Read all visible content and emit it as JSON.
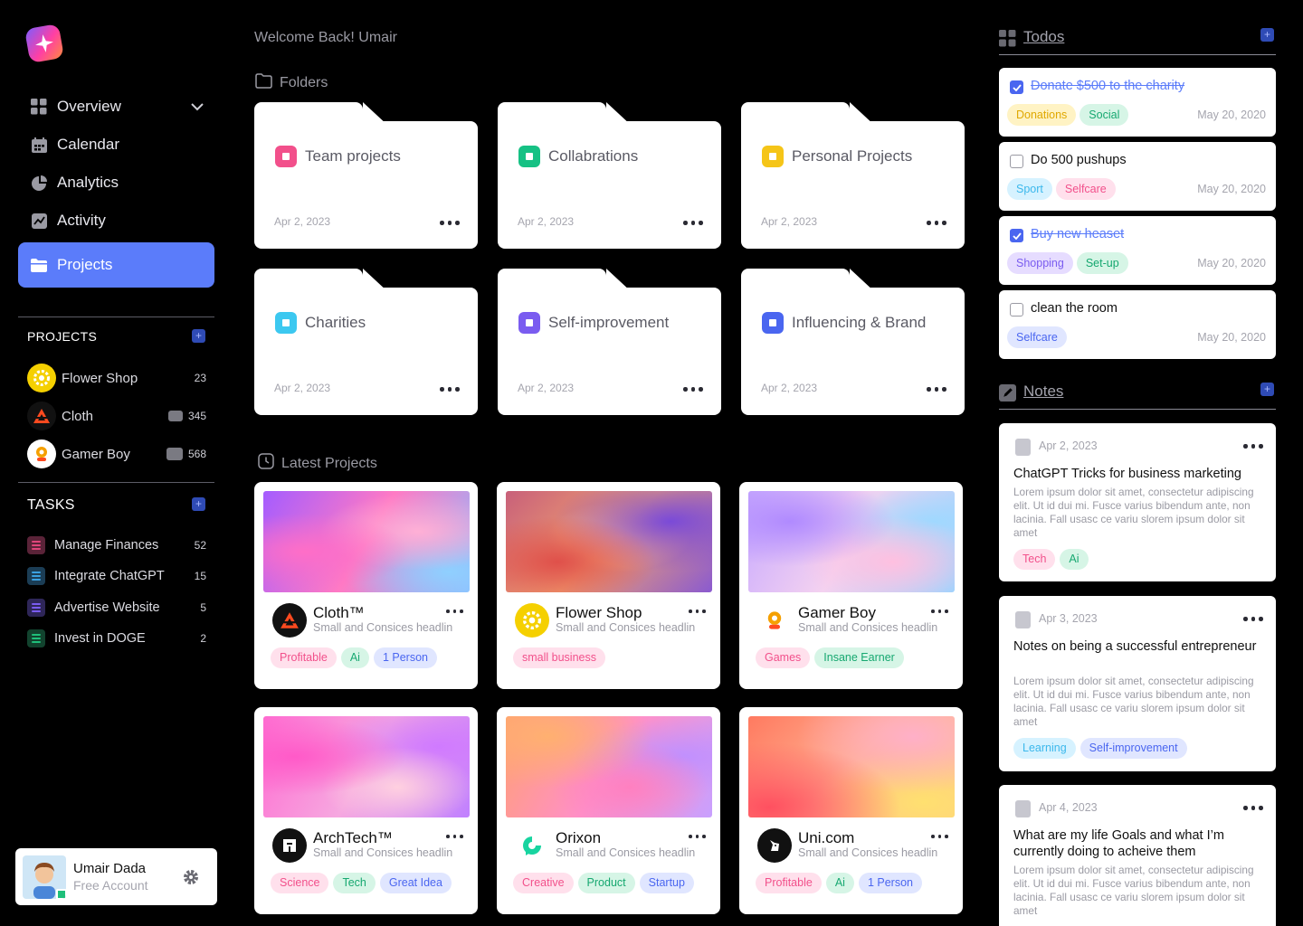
{
  "colors": {
    "accent": "#5b7cfa",
    "background": "#000000"
  },
  "sidebar": {
    "nav": [
      {
        "label": "Overview",
        "icon": "grid-icon"
      },
      {
        "label": "Calendar",
        "icon": "calendar-icon"
      },
      {
        "label": "Analytics",
        "icon": "pie-chart-icon"
      },
      {
        "label": "Activity",
        "icon": "activity-icon"
      },
      {
        "label": "Projects",
        "icon": "folder-icon",
        "active": true
      }
    ],
    "projects_title": "PROJECTS",
    "projects": [
      {
        "name": "Flower Shop",
        "count": "23"
      },
      {
        "name": "Cloth",
        "count": "345"
      },
      {
        "name": "Gamer Boy",
        "count": "568"
      }
    ],
    "tasks_title": "TASKS",
    "tasks": [
      {
        "name": "Manage Finances",
        "count": "52",
        "color": "#e0457b"
      },
      {
        "name": "Integrate ChatGPT",
        "count": "15",
        "color": "#3aa0e0"
      },
      {
        "name": "Advertise Website",
        "count": "5",
        "color": "#7a5cf0"
      },
      {
        "name": "Invest in DOGE",
        "count": "2",
        "color": "#1fbf7a"
      }
    ],
    "user": {
      "name": "Umair Dada",
      "plan": "Free Account"
    }
  },
  "main": {
    "welcome": "Welcome Back! Umair",
    "folders_label": "Folders",
    "folders": [
      {
        "name": "Team projects",
        "date": "Apr 2, 2023",
        "color": "#f2508b"
      },
      {
        "name": "Collabrations",
        "date": "Apr 2, 2023",
        "color": "#16c184"
      },
      {
        "name": "Personal Projects",
        "date": "Apr 2, 2023",
        "color": "#f5c518"
      },
      {
        "name": "Charities",
        "date": "Apr 2, 2023",
        "color": "#3cc8f0"
      },
      {
        "name": "Self-improvement",
        "date": "Apr 2, 2023",
        "color": "#7a5cf0"
      },
      {
        "name": "Influencing & Brand",
        "date": "Apr 2, 2023",
        "color": "#4a66f0"
      }
    ],
    "latest_label": "Latest Projects",
    "projects": [
      {
        "name": "Cloth™",
        "sub": "Small and Consices headlin",
        "tags": [
          "Profitable",
          "Ai",
          "1 Person"
        ]
      },
      {
        "name": "Flower Shop",
        "sub": "Small and Consices headlin",
        "tags": [
          "small business"
        ]
      },
      {
        "name": "Gamer Boy",
        "sub": "Small and Consices headlin",
        "tags": [
          "Games",
          "Insane Earner"
        ]
      },
      {
        "name": "ArchTech™",
        "sub": "Small and Consices headlin",
        "tags": [
          "Science",
          "Tech",
          "Great Idea"
        ]
      },
      {
        "name": "Orixon",
        "sub": "Small and Consices headlin",
        "tags": [
          "Creative",
          "Product",
          "Startup"
        ]
      },
      {
        "name": "Uni.com",
        "sub": "Small and Consices headlin",
        "tags": [
          "Profitable",
          "Ai",
          "1 Person"
        ]
      }
    ]
  },
  "right": {
    "todos_label": "Todos",
    "todos": [
      {
        "text": "Donate $500 to the charity",
        "done": true,
        "tags": [
          "Donations",
          "Social"
        ],
        "date": "May 20, 2020"
      },
      {
        "text": "Do 500 pushups",
        "done": false,
        "tags": [
          "Sport",
          "Selfcare"
        ],
        "date": "May 20, 2020"
      },
      {
        "text": "Buy new heaset",
        "done": true,
        "tags": [
          "Shopping",
          "Set-up"
        ],
        "date": "May 20, 2020"
      },
      {
        "text": "clean the room",
        "done": false,
        "tags": [
          "Selfcare"
        ],
        "date": "May 20, 2020"
      }
    ],
    "notes_label": "Notes",
    "notes": [
      {
        "date": "Apr 2, 2023",
        "title": "ChatGPT Tricks for business marketing",
        "body": "Lorem ipsum dolor sit amet, consectetur adipiscing elit. Ut id dui mi. Fusce varius bibendum ante, non lacinia. Fall usasc ce variu slorem ipsum dolor sit amet",
        "tags": [
          "Tech",
          "Ai"
        ]
      },
      {
        "date": "Apr 3, 2023",
        "title": "Notes on being a successful entrepreneur",
        "body": "Lorem ipsum dolor sit amet, consectetur adipiscing elit. Ut id dui mi. Fusce varius bibendum ante, non lacinia. Fall usasc ce variu slorem ipsum dolor sit amet",
        "tags": [
          "Learning",
          "Self-improvement"
        ]
      },
      {
        "date": "Apr 4, 2023",
        "title": "What are my life Goals and what I’m currently doing to acheive them",
        "body": "Lorem ipsum dolor sit amet, consectetur adipiscing elit. Ut id dui mi. Fusce varius bibendum ante, non lacinia. Fall usasc ce variu slorem ipsum dolor sit amet",
        "tags": []
      }
    ]
  }
}
